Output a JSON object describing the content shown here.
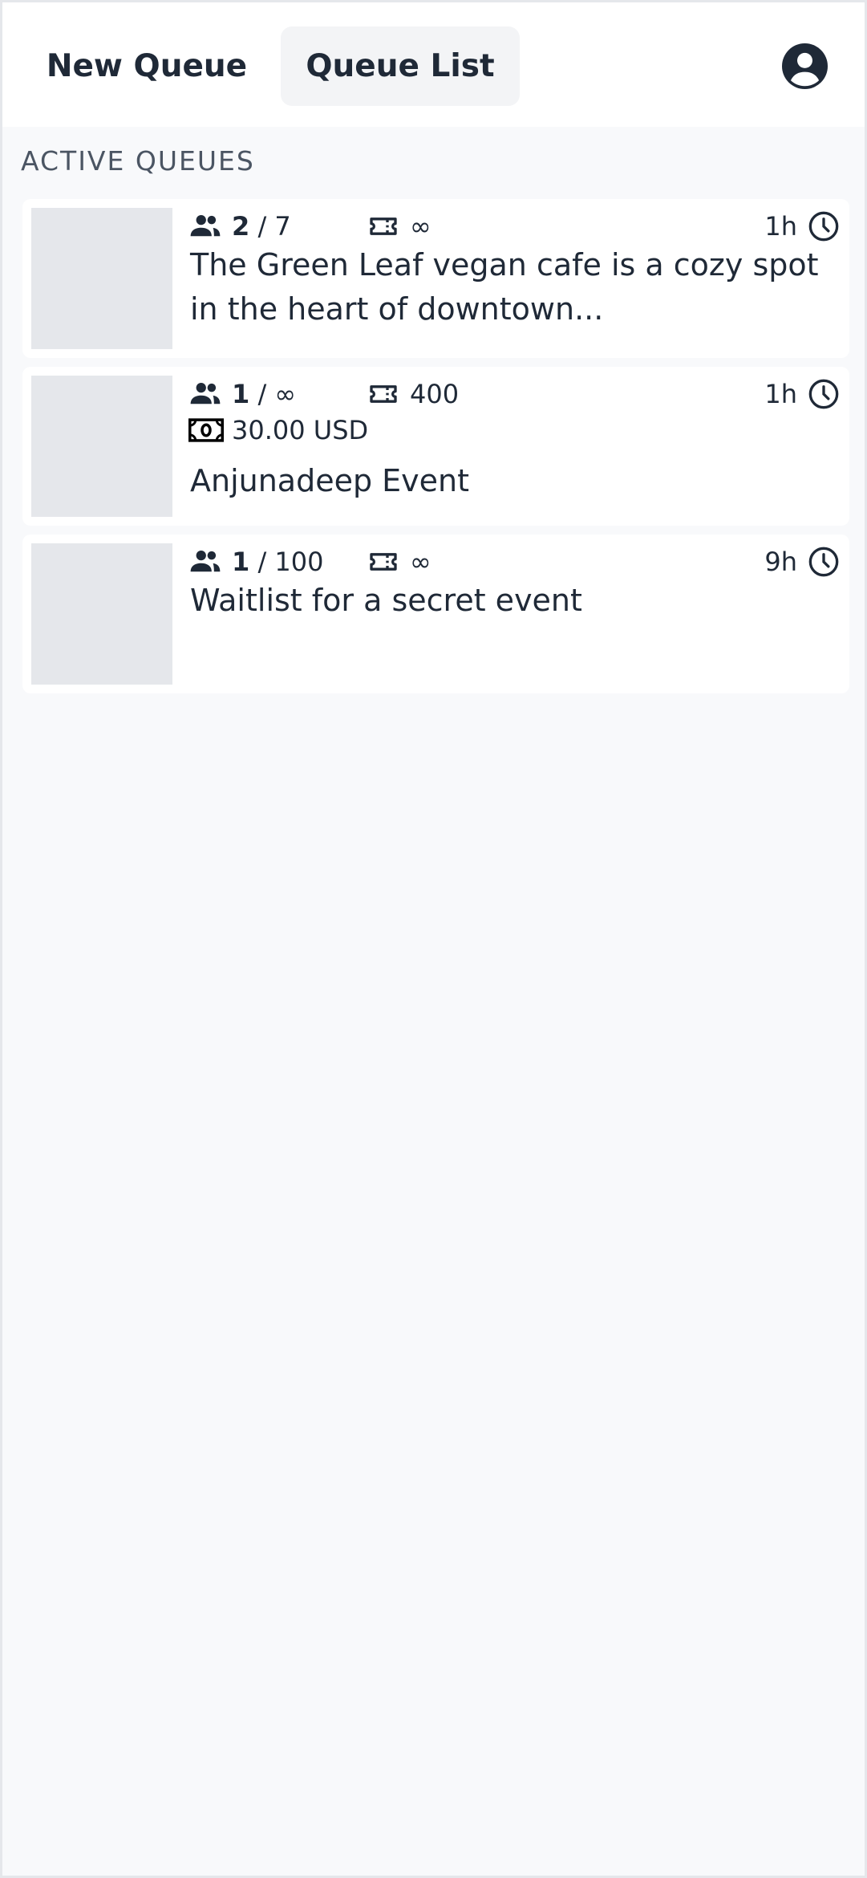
{
  "header": {
    "tabs": [
      {
        "label": "New Queue",
        "active": false
      },
      {
        "label": "Queue List",
        "active": true
      }
    ],
    "profile_icon": "user-circle-icon"
  },
  "section_title": "ACTIVE QUEUES",
  "queues": [
    {
      "members": "2",
      "capacity": "/ 7",
      "tickets": "∞",
      "time": "1h",
      "description": "The Green Leaf vegan cafe is a cozy spot in the heart of downtown..."
    },
    {
      "members": "1",
      "capacity": "/ ∞",
      "tickets": "400",
      "price": "30.00 USD",
      "time": "1h",
      "description": "Anjunadeep Event"
    },
    {
      "members": "1",
      "capacity": "/ 100",
      "tickets": "∞",
      "time": "9h",
      "description": "Waitlist for a secret event"
    }
  ],
  "colors": {
    "text": "#1f2937",
    "page_background": "#f8f9fb",
    "active_tab": "#f3f4f6",
    "thumbnail_placeholder": "#e5e7eb",
    "section_title": "#4b5563"
  },
  "icons": {
    "members": "users-icon",
    "tickets": "ticket-icon",
    "price": "banknote-icon",
    "time": "clock-icon"
  }
}
